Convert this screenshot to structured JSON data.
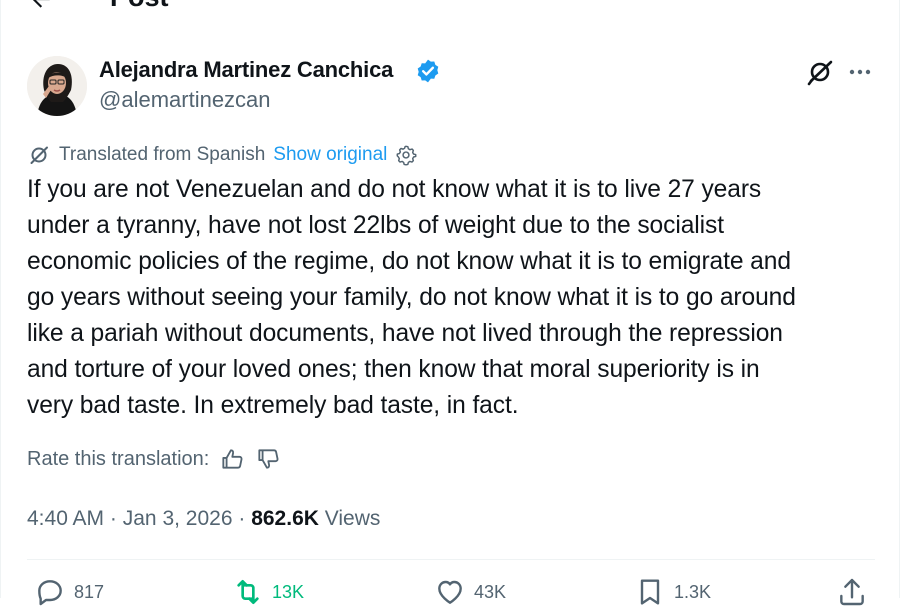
{
  "header": {
    "title": "Post",
    "back_icon": "arrow-left-icon"
  },
  "author": {
    "name": "Alejandra Martinez Canchica",
    "handle": "@alemartinezcan",
    "verified_icon": "verified-badge-icon",
    "avatar": "avatar"
  },
  "top_actions": {
    "grok_icon": "grok-icon",
    "more_icon": "more-icon"
  },
  "translation": {
    "label": "Translated from Spanish",
    "show_original": "Show original",
    "settings_icon": "gear-icon"
  },
  "tweet": {
    "text": "If you are not Venezuelan and do not know what it is to live 27 years\nunder a tyranny, have not lost 22lbs of weight due to the socialist\neconomic policies of the regime, do not know what it is to emigrate and\ngo years without seeing your family, do not know what it is to go around\nlike a pariah without documents, have not lived through the repression\nand torture of your loved ones; then know that moral superiority is in\nvery bad taste. In extremely bad taste, in fact."
  },
  "rate": {
    "label": "Rate this translation:"
  },
  "meta": {
    "time": "4:40 AM",
    "sep1": "·",
    "date": "Jan 3, 2026",
    "sep2": "·",
    "views_count": "862.6K",
    "views_label": "Views"
  },
  "actions": {
    "replies": "817",
    "reposts": "13K",
    "likes": "43K",
    "bookmarks": "1.3K"
  },
  "colors": {
    "accent": "#1d9bf0",
    "muted": "#536471",
    "text": "#0f1419",
    "repost": "#00ba7c"
  }
}
